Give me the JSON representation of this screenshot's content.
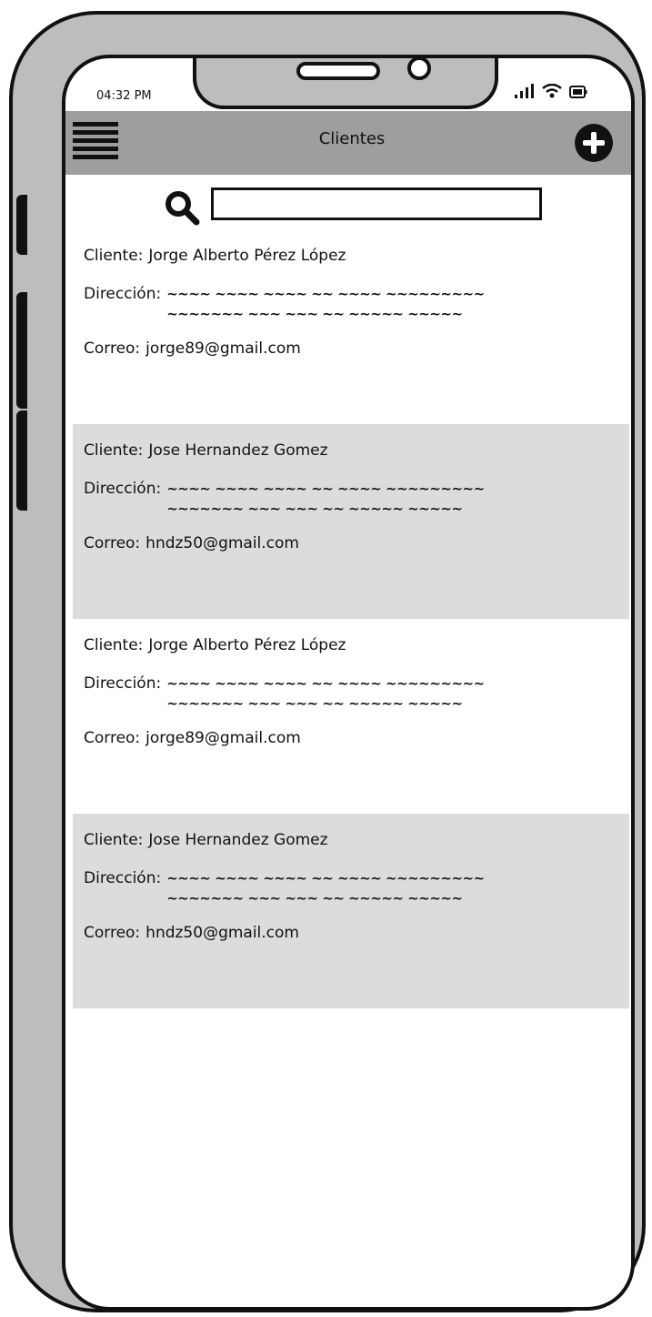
{
  "status_bar": {
    "time": "04:32 PM"
  },
  "appbar": {
    "title": "Clientes",
    "menu_icon": "hamburger-menu-icon",
    "add_icon": "plus-circle-icon"
  },
  "search": {
    "icon": "search-icon",
    "value": "",
    "placeholder": ""
  },
  "clients": [
    {
      "client_label": "Cliente:",
      "client_name": "Jorge Alberto Pérez López",
      "address_label": "Dirección:",
      "address_line1": "~~~~ ~~~~ ~~~~ ~~ ~~~~ ~~~~~~~~~",
      "address_line2": "~~~~~~~ ~~~ ~~~ ~~ ~~~~~ ~~~~~",
      "email_label": "Correo:",
      "email": "jorge89@gmail.com"
    },
    {
      "client_label": "Cliente:",
      "client_name": "Jose Hernandez Gomez",
      "address_label": "Dirección:",
      "address_line1": "~~~~ ~~~~ ~~~~ ~~ ~~~~ ~~~~~~~~~",
      "address_line2": "~~~~~~~ ~~~ ~~~ ~~ ~~~~~ ~~~~~",
      "email_label": "Correo:",
      "email": "hndz50@gmail.com"
    },
    {
      "client_label": "Cliente:",
      "client_name": "Jorge Alberto Pérez López",
      "address_label": "Dirección:",
      "address_line1": "~~~~ ~~~~ ~~~~ ~~ ~~~~ ~~~~~~~~~",
      "address_line2": "~~~~~~~ ~~~ ~~~ ~~ ~~~~~ ~~~~~",
      "email_label": "Correo:",
      "email": "jorge89@gmail.com"
    },
    {
      "client_label": "Cliente:",
      "client_name": "Jose Hernandez Gomez",
      "address_label": "Dirección:",
      "address_line1": "~~~~ ~~~~ ~~~~ ~~ ~~~~ ~~~~~~~~~",
      "address_line2": "~~~~~~~ ~~~ ~~~ ~~ ~~~~~ ~~~~~",
      "email_label": "Correo:",
      "email": "hndz50@gmail.com"
    }
  ]
}
